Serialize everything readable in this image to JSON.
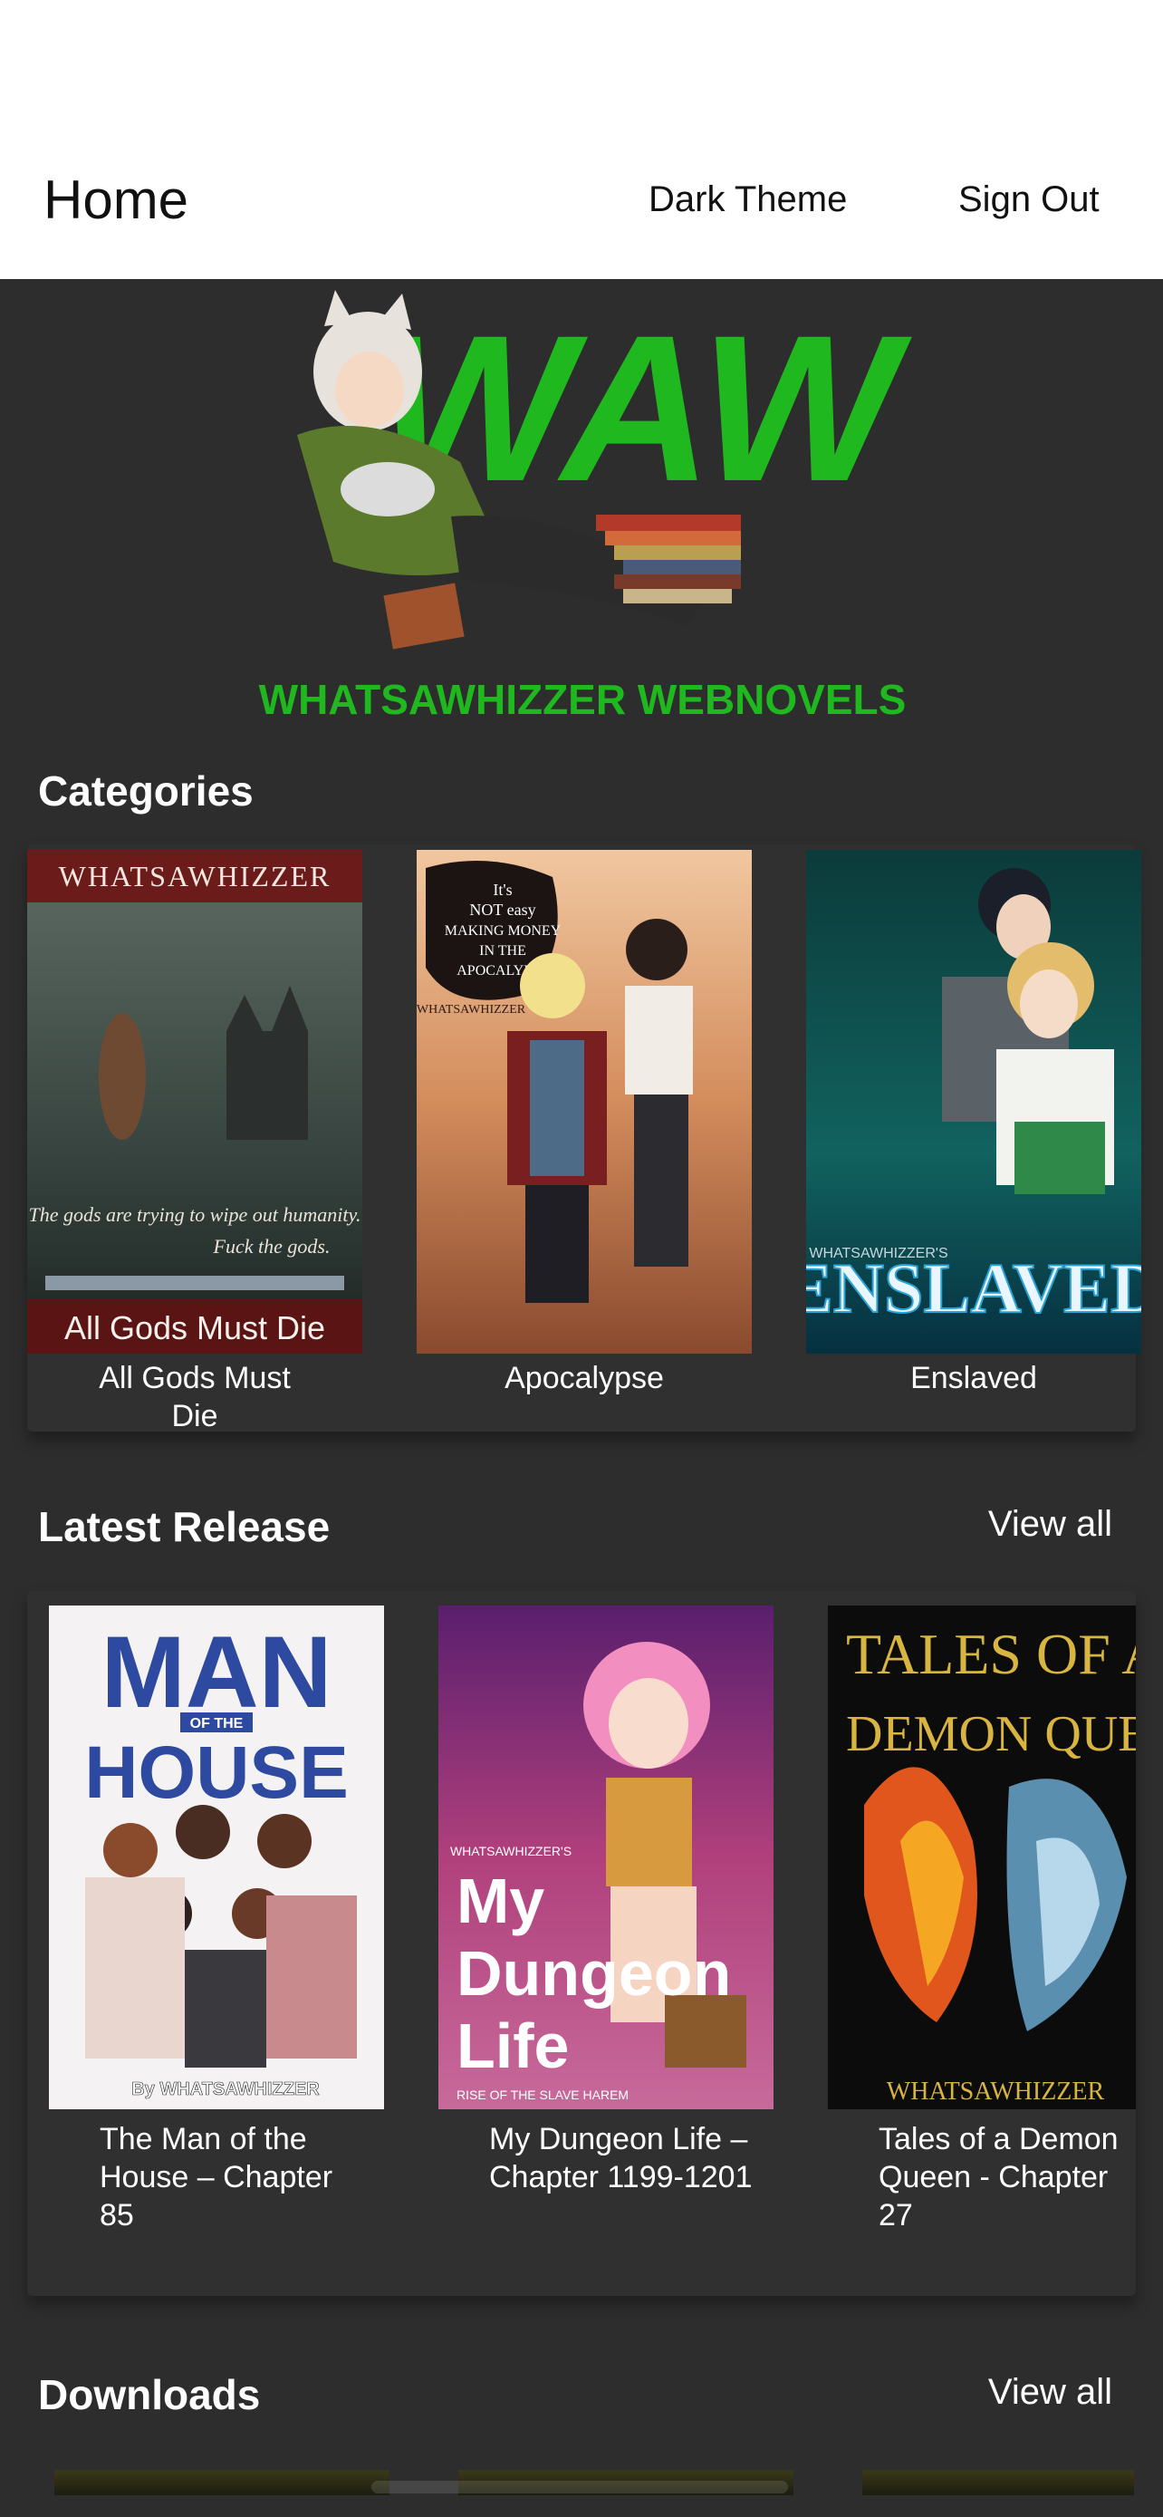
{
  "header": {
    "title": "Home",
    "dark_theme_label": "Dark Theme",
    "sign_out_label": "Sign Out"
  },
  "logo": {
    "letters": "WAW",
    "tagline": "WHATSAWHIZZER WEBNOVELS"
  },
  "categories": {
    "title": "Categories",
    "items": [
      {
        "label": "All Gods Must Die",
        "cover_brand": "WHATSAWHIZZER",
        "cover_tagline_1": "The gods are trying to wipe out humanity.",
        "cover_tagline_2": "Fuck the gods.",
        "cover_title": "All Gods Must Die"
      },
      {
        "label": "Apocalypse",
        "cover_title_1": "It's",
        "cover_title_2": "NOT easy",
        "cover_title_3": "MAKING MONEY",
        "cover_title_4": "IN THE",
        "cover_title_5": "APOCALYPSE",
        "cover_brand": "WHATSAWHIZZER"
      },
      {
        "label": "Enslaved",
        "cover_brand": "WHATSAWHIZZER'S",
        "cover_title": "ENSLAVED"
      }
    ]
  },
  "latest_release": {
    "title": "Latest Release",
    "view_all_label": "View all",
    "items": [
      {
        "label": "The Man of the House – Chapter 85",
        "cover_title_1": "MAN",
        "cover_title_2": "OF THE",
        "cover_title_3": "HOUSE",
        "cover_brand": "By WHATSAWHIZZER"
      },
      {
        "label": "My Dungeon Life – Chapter 1199-1201",
        "cover_brand": "WHATSAWHIZZER'S",
        "cover_title_1": "My",
        "cover_title_2": "Dungeon",
        "cover_title_3": "Life",
        "cover_subtitle": "RISE OF THE SLAVE HAREM"
      },
      {
        "label": "Tales of a Demon Queen - Chapter 27",
        "cover_title_1": "TALES OF A",
        "cover_title_2": "DEMON QUEEN",
        "cover_brand": "WHATSAWHIZZER"
      }
    ]
  },
  "downloads": {
    "title": "Downloads",
    "view_all_label": "View all"
  },
  "colors": {
    "background": "#2d2d2d",
    "header_bg": "#ffffff",
    "logo_green": "#1fb81f"
  }
}
